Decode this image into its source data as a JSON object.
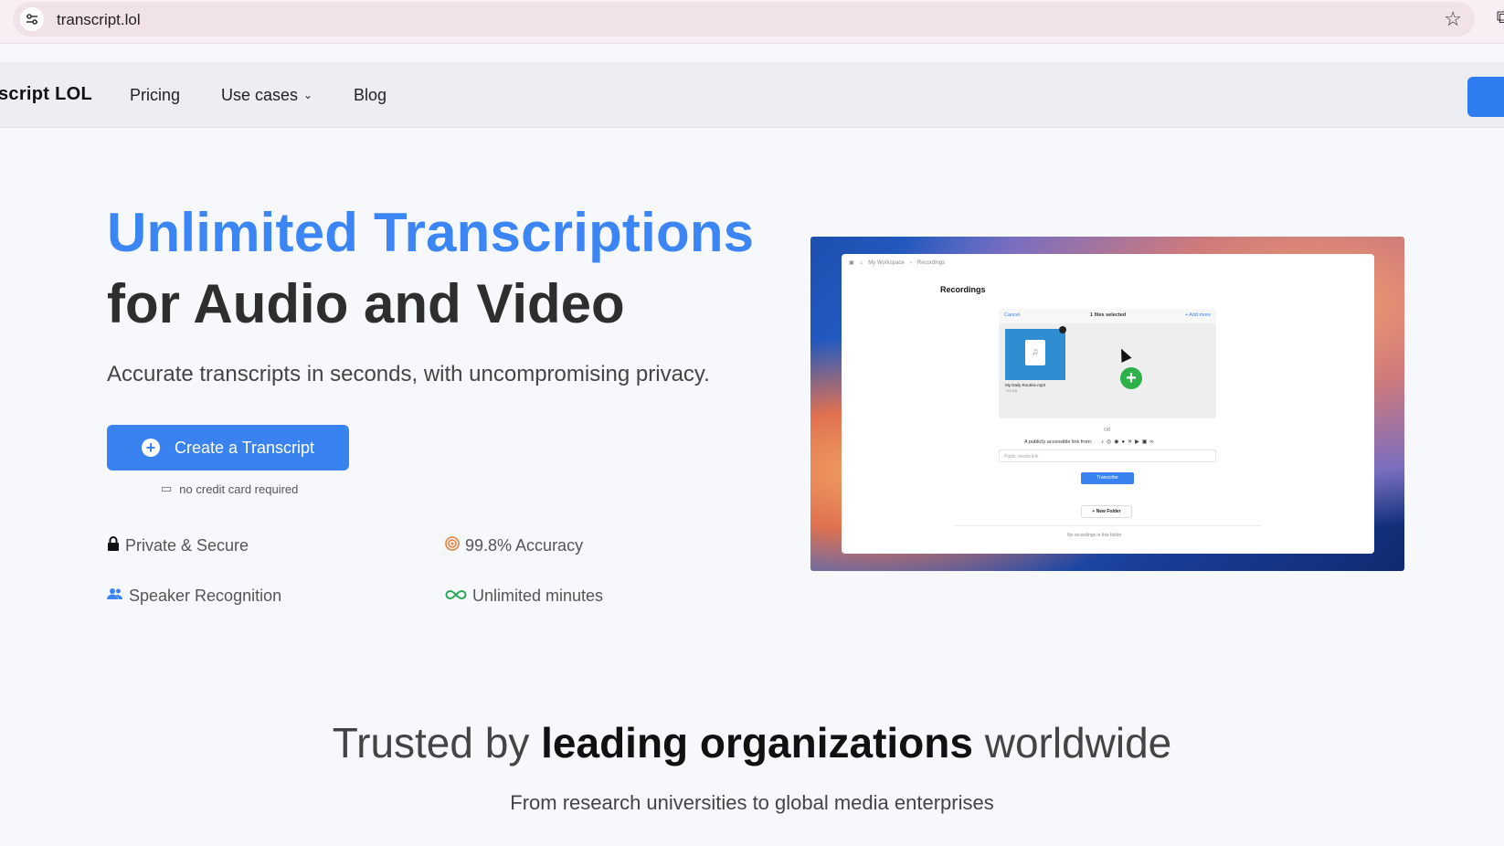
{
  "browser": {
    "url": "transcript.lol",
    "site_info_icon": "tune-icon",
    "bookmark_icon": "star-icon"
  },
  "nav": {
    "brand": "script LOL",
    "items": [
      {
        "label": "Pricing"
      },
      {
        "label": "Use cases"
      },
      {
        "label": "Blog"
      }
    ],
    "accent": "#2f7cf0"
  },
  "hero": {
    "title_line1": "Unlimited Transcriptions",
    "title_line2": "for Audio and Video",
    "subtitle": "Accurate transcripts in seconds, with uncompromising privacy.",
    "cta_label": "Create a Transcript",
    "cta_note": "no credit card required",
    "features": [
      {
        "label": "Private & Secure",
        "icon": "lock-icon"
      },
      {
        "label": "99.8% Accuracy",
        "icon": "target-icon"
      },
      {
        "label": "Speaker Recognition",
        "icon": "users-icon"
      },
      {
        "label": "Unlimited minutes",
        "icon": "infinity-icon"
      }
    ],
    "title_color": "#3b86f4"
  },
  "preview": {
    "crumbs": [
      "My Workspace",
      "Recordings"
    ],
    "title": "Recordings",
    "upload": {
      "cancel": "Cancel",
      "selected": "1 files selected",
      "add_more": "+ Add more",
      "file_name": "My Daily Routine.mp3",
      "file_size": "710 KB"
    },
    "or": "OR",
    "link_label": "A publicly accessible link from:",
    "link_placeholder": "Public media link",
    "transcribe": "Transcribe",
    "new_folder": "+ New Folder",
    "empty": "No recordings in this folder"
  },
  "trusted": {
    "prefix": "Trusted by",
    "bold": "leading organizations",
    "suffix": "worldwide",
    "subtitle": "From research universities to global media enterprises"
  }
}
